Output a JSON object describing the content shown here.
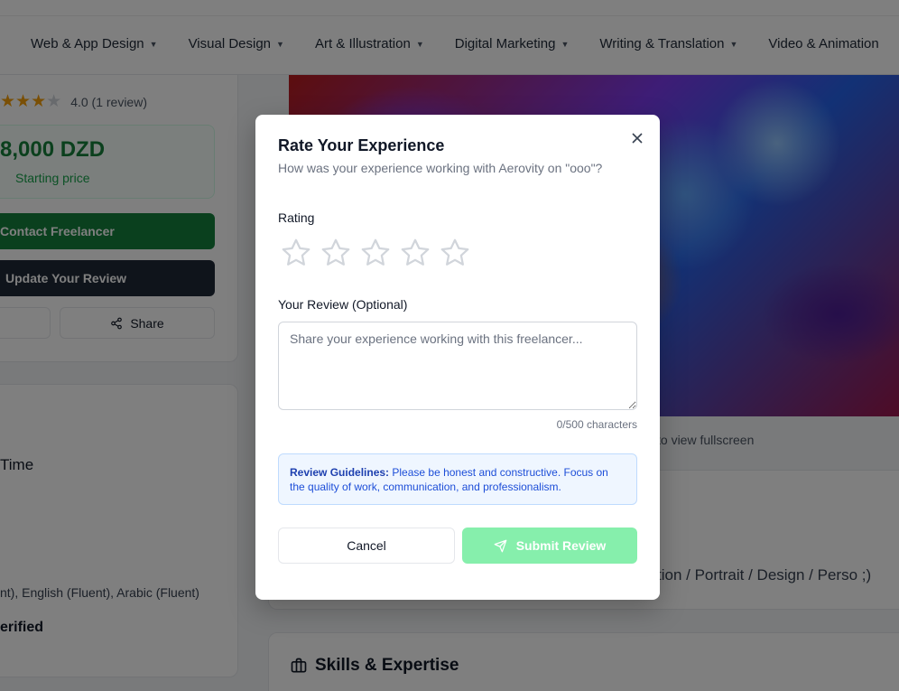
{
  "nav": {
    "items": [
      {
        "label": "Web & App Design"
      },
      {
        "label": "Visual Design"
      },
      {
        "label": "Art & Illustration"
      },
      {
        "label": "Digital Marketing"
      },
      {
        "label": "Writing & Translation"
      },
      {
        "label": "Video & Animation"
      }
    ]
  },
  "sidebar": {
    "rating_text": "4.0 (1 review)",
    "rating_value": 4,
    "price": "8,000 DZD",
    "price_sub": "Starting price",
    "contact_label": "Contact Freelancer",
    "update_label": "Update Your Review",
    "share_label": "Share",
    "time_text": "Time",
    "languages_text": "nt), English (Fluent), Arabic (Fluent)",
    "verified_text": "erified"
  },
  "main": {
    "caption": "to view fullscreen",
    "description_fragment": "tion / Portrait / Design / Perso ;)",
    "skills_title": "Skills & Expertise"
  },
  "modal": {
    "title": "Rate Your Experience",
    "subtitle": "How was your experience working with Aerovity on \"ooo\"?",
    "rating_label": "Rating",
    "stars_selected": 0,
    "stars_total": 5,
    "review_label": "Your Review (Optional)",
    "review_placeholder": "Share your experience working with this freelancer...",
    "review_value": "",
    "char_count": "0/500 characters",
    "guidelines_title": "Review Guidelines:",
    "guidelines_text": " Please be honest and constructive. Focus on the quality of work, communication, and professionalism.",
    "cancel_label": "Cancel",
    "submit_label": "Submit Review"
  },
  "colors": {
    "brand_green": "#15803d",
    "submit_disabled": "#86efac",
    "guide_bg": "#eff6ff",
    "star_empty": "#d1d5db"
  }
}
